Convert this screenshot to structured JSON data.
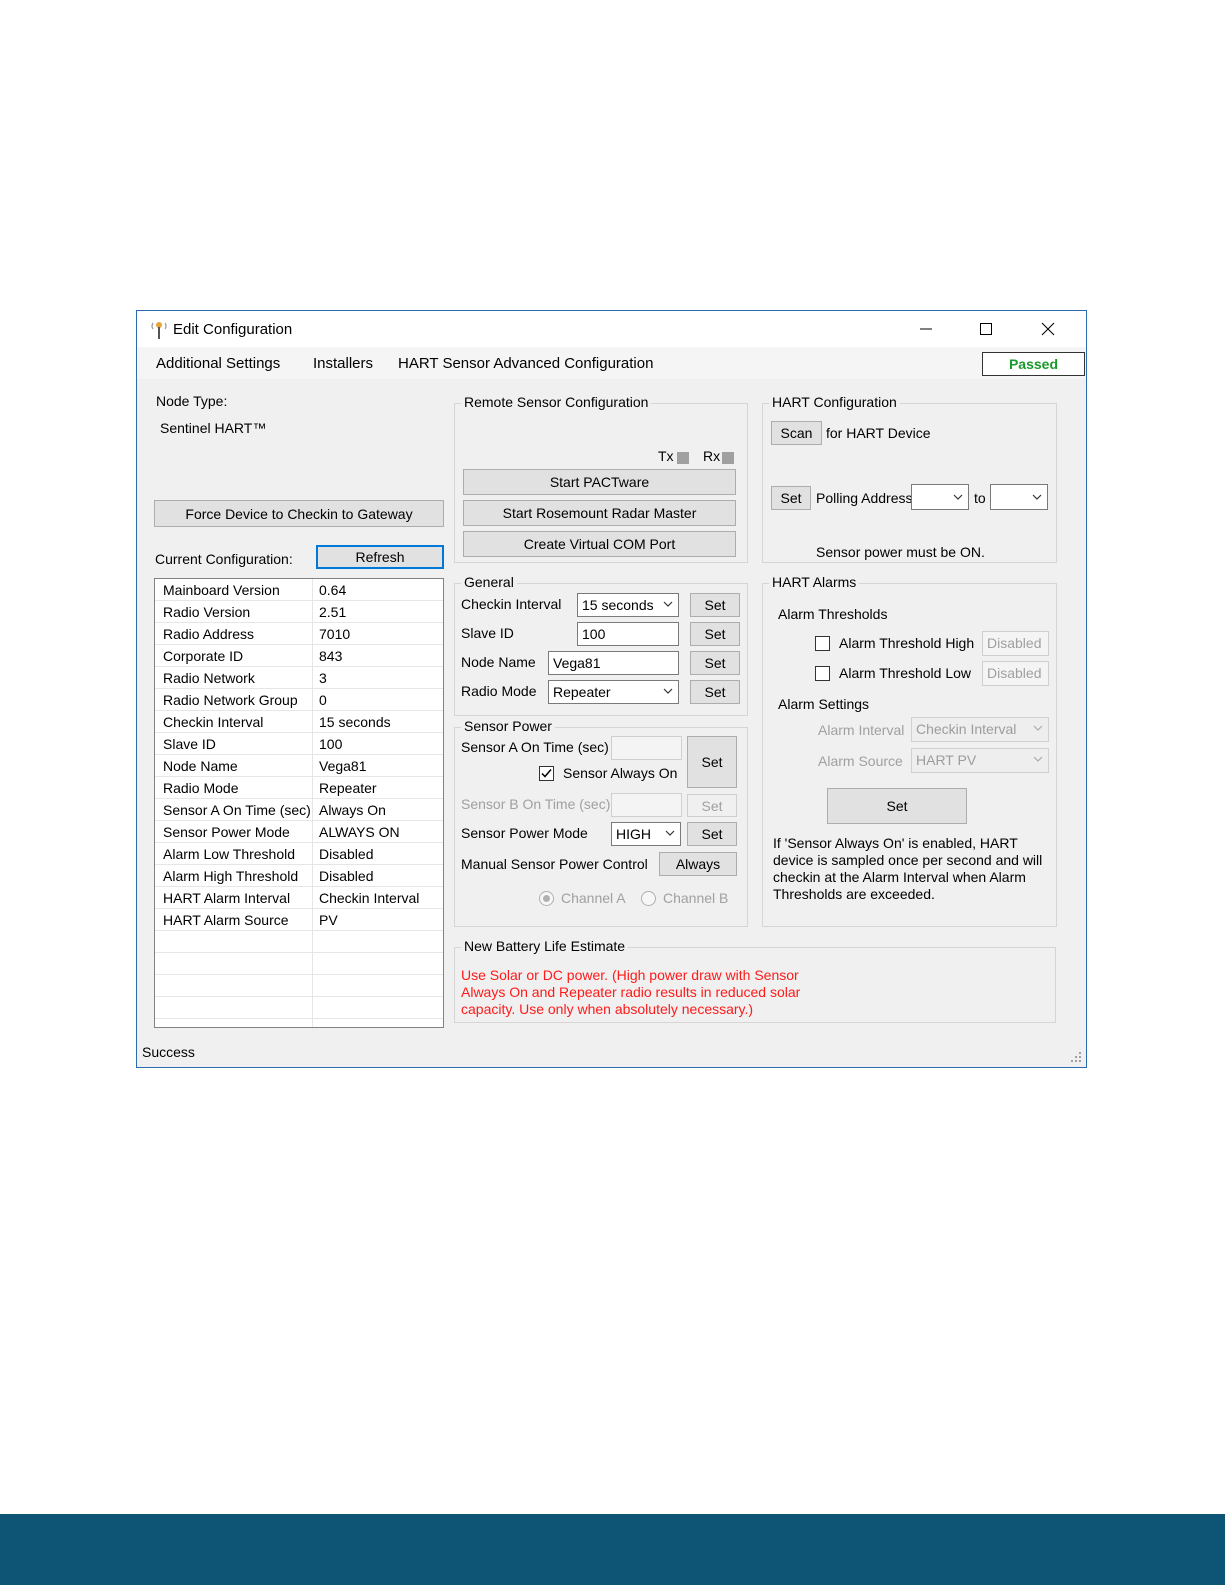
{
  "window": {
    "title": "Edit Configuration",
    "status_text": "Success",
    "status_badge": "Passed"
  },
  "menu": {
    "items": [
      "Additional Settings",
      "Installers",
      "HART Sensor Advanced Configuration"
    ]
  },
  "left": {
    "node_type_label": "Node Type:",
    "node_type_value": "Sentinel HART™",
    "force_checkin_button": "Force Device to Checkin to Gateway",
    "current_config_label": "Current Configuration:",
    "refresh_button": "Refresh",
    "config_rows": [
      {
        "key": "Mainboard Version",
        "value": "0.64"
      },
      {
        "key": "Radio Version",
        "value": "2.51"
      },
      {
        "key": "Radio Address",
        "value": "7010"
      },
      {
        "key": "Corporate ID",
        "value": "843"
      },
      {
        "key": "Radio Network",
        "value": "3"
      },
      {
        "key": "Radio Network Group",
        "value": "0"
      },
      {
        "key": "Checkin Interval",
        "value": "15 seconds"
      },
      {
        "key": "Slave ID",
        "value": "100"
      },
      {
        "key": "Node Name",
        "value": "Vega81"
      },
      {
        "key": "Radio Mode",
        "value": "Repeater"
      },
      {
        "key": "Sensor A On Time (sec)",
        "value": "Always On"
      },
      {
        "key": "Sensor Power Mode",
        "value": "ALWAYS ON"
      },
      {
        "key": "Alarm Low Threshold",
        "value": "Disabled"
      },
      {
        "key": "Alarm High Threshold",
        "value": "Disabled"
      },
      {
        "key": "HART Alarm Interval",
        "value": "Checkin Interval"
      },
      {
        "key": "HART Alarm Source",
        "value": "PV"
      }
    ]
  },
  "remote_sensor": {
    "title": "Remote Sensor Configuration",
    "tx_label": "Tx",
    "rx_label": "Rx",
    "start_pactware": "Start PACTware",
    "start_rosemount": "Start Rosemount Radar Master",
    "create_com_port": "Create Virtual COM Port"
  },
  "general": {
    "title": "General",
    "checkin_interval_label": "Checkin Interval",
    "checkin_interval_value": "15 seconds",
    "slave_id_label": "Slave ID",
    "slave_id_value": "100",
    "node_name_label": "Node Name",
    "node_name_value": "Vega81",
    "radio_mode_label": "Radio Mode",
    "radio_mode_value": "Repeater",
    "set_label": "Set"
  },
  "sensor_power": {
    "title": "Sensor Power",
    "sensor_a_label": "Sensor A On Time (sec)",
    "sensor_a_value": "",
    "always_on_label": "Sensor Always On",
    "always_on_checked": true,
    "sensor_b_label": "Sensor B On Time (sec)",
    "sensor_b_value": "",
    "power_mode_label": "Sensor Power Mode",
    "power_mode_value": "HIGH",
    "manual_control_label": "Manual Sensor Power Control",
    "manual_control_button": "Always",
    "channel_a": "Channel A",
    "channel_b": "Channel B",
    "set_label": "Set"
  },
  "battery": {
    "title": "New Battery Life Estimate",
    "warning": "Use Solar or DC power. (High power draw with Sensor Always On and Repeater radio results in reduced solar capacity. Use only when absolutely necessary.)",
    "warning_lines": [
      "Use Solar or DC power. (High power draw with Sensor",
      "Always On and Repeater radio results in reduced solar",
      "capacity. Use only when absolutely necessary.)"
    ]
  },
  "hart_config": {
    "title": "HART Configuration",
    "scan_button": "Scan",
    "scan_label": "for HART Device",
    "set_button": "Set",
    "polling_label": "Polling Address",
    "polling_from": "",
    "to_label": "to",
    "polling_to": "",
    "power_note": "Sensor power must be ON."
  },
  "hart_alarms": {
    "title": "HART Alarms",
    "thresholds_label": "Alarm Thresholds",
    "high_label": "Alarm Threshold High",
    "high_value": "Disabled",
    "low_label": "Alarm Threshold Low",
    "low_value": "Disabled",
    "settings_label": "Alarm Settings",
    "interval_label": "Alarm Interval",
    "interval_value": "Checkin Interval",
    "source_label": "Alarm Source",
    "source_value": "HART PV",
    "set_button": "Set",
    "note": "If 'Sensor Always On' is enabled, HART device is sampled once per second and will checkin at the Alarm Interval when Alarm Thresholds are exceeded.",
    "note_lines": [
      "If 'Sensor Always On' is enabled, HART",
      "device is sampled once per second and will",
      "checkin at the Alarm Interval when Alarm",
      "Thresholds are exceeded."
    ]
  },
  "colors": {
    "footer_band": "#0e5474",
    "passed_text": "#1a9a2a",
    "warning_text": "#ff1a1a",
    "focus_border": "#0078d7"
  }
}
